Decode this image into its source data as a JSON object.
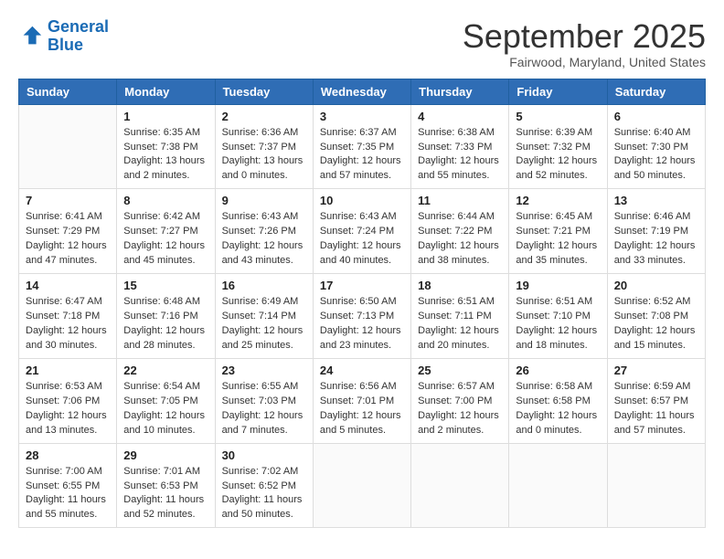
{
  "header": {
    "logo_line1": "General",
    "logo_line2": "Blue",
    "month": "September 2025",
    "location": "Fairwood, Maryland, United States"
  },
  "weekdays": [
    "Sunday",
    "Monday",
    "Tuesday",
    "Wednesday",
    "Thursday",
    "Friday",
    "Saturday"
  ],
  "weeks": [
    [
      {
        "day": "",
        "sunrise": "",
        "sunset": "",
        "daylight": ""
      },
      {
        "day": "1",
        "sunrise": "Sunrise: 6:35 AM",
        "sunset": "Sunset: 7:38 PM",
        "daylight": "Daylight: 13 hours and 2 minutes."
      },
      {
        "day": "2",
        "sunrise": "Sunrise: 6:36 AM",
        "sunset": "Sunset: 7:37 PM",
        "daylight": "Daylight: 13 hours and 0 minutes."
      },
      {
        "day": "3",
        "sunrise": "Sunrise: 6:37 AM",
        "sunset": "Sunset: 7:35 PM",
        "daylight": "Daylight: 12 hours and 57 minutes."
      },
      {
        "day": "4",
        "sunrise": "Sunrise: 6:38 AM",
        "sunset": "Sunset: 7:33 PM",
        "daylight": "Daylight: 12 hours and 55 minutes."
      },
      {
        "day": "5",
        "sunrise": "Sunrise: 6:39 AM",
        "sunset": "Sunset: 7:32 PM",
        "daylight": "Daylight: 12 hours and 52 minutes."
      },
      {
        "day": "6",
        "sunrise": "Sunrise: 6:40 AM",
        "sunset": "Sunset: 7:30 PM",
        "daylight": "Daylight: 12 hours and 50 minutes."
      }
    ],
    [
      {
        "day": "7",
        "sunrise": "Sunrise: 6:41 AM",
        "sunset": "Sunset: 7:29 PM",
        "daylight": "Daylight: 12 hours and 47 minutes."
      },
      {
        "day": "8",
        "sunrise": "Sunrise: 6:42 AM",
        "sunset": "Sunset: 7:27 PM",
        "daylight": "Daylight: 12 hours and 45 minutes."
      },
      {
        "day": "9",
        "sunrise": "Sunrise: 6:43 AM",
        "sunset": "Sunset: 7:26 PM",
        "daylight": "Daylight: 12 hours and 43 minutes."
      },
      {
        "day": "10",
        "sunrise": "Sunrise: 6:43 AM",
        "sunset": "Sunset: 7:24 PM",
        "daylight": "Daylight: 12 hours and 40 minutes."
      },
      {
        "day": "11",
        "sunrise": "Sunrise: 6:44 AM",
        "sunset": "Sunset: 7:22 PM",
        "daylight": "Daylight: 12 hours and 38 minutes."
      },
      {
        "day": "12",
        "sunrise": "Sunrise: 6:45 AM",
        "sunset": "Sunset: 7:21 PM",
        "daylight": "Daylight: 12 hours and 35 minutes."
      },
      {
        "day": "13",
        "sunrise": "Sunrise: 6:46 AM",
        "sunset": "Sunset: 7:19 PM",
        "daylight": "Daylight: 12 hours and 33 minutes."
      }
    ],
    [
      {
        "day": "14",
        "sunrise": "Sunrise: 6:47 AM",
        "sunset": "Sunset: 7:18 PM",
        "daylight": "Daylight: 12 hours and 30 minutes."
      },
      {
        "day": "15",
        "sunrise": "Sunrise: 6:48 AM",
        "sunset": "Sunset: 7:16 PM",
        "daylight": "Daylight: 12 hours and 28 minutes."
      },
      {
        "day": "16",
        "sunrise": "Sunrise: 6:49 AM",
        "sunset": "Sunset: 7:14 PM",
        "daylight": "Daylight: 12 hours and 25 minutes."
      },
      {
        "day": "17",
        "sunrise": "Sunrise: 6:50 AM",
        "sunset": "Sunset: 7:13 PM",
        "daylight": "Daylight: 12 hours and 23 minutes."
      },
      {
        "day": "18",
        "sunrise": "Sunrise: 6:51 AM",
        "sunset": "Sunset: 7:11 PM",
        "daylight": "Daylight: 12 hours and 20 minutes."
      },
      {
        "day": "19",
        "sunrise": "Sunrise: 6:51 AM",
        "sunset": "Sunset: 7:10 PM",
        "daylight": "Daylight: 12 hours and 18 minutes."
      },
      {
        "day": "20",
        "sunrise": "Sunrise: 6:52 AM",
        "sunset": "Sunset: 7:08 PM",
        "daylight": "Daylight: 12 hours and 15 minutes."
      }
    ],
    [
      {
        "day": "21",
        "sunrise": "Sunrise: 6:53 AM",
        "sunset": "Sunset: 7:06 PM",
        "daylight": "Daylight: 12 hours and 13 minutes."
      },
      {
        "day": "22",
        "sunrise": "Sunrise: 6:54 AM",
        "sunset": "Sunset: 7:05 PM",
        "daylight": "Daylight: 12 hours and 10 minutes."
      },
      {
        "day": "23",
        "sunrise": "Sunrise: 6:55 AM",
        "sunset": "Sunset: 7:03 PM",
        "daylight": "Daylight: 12 hours and 7 minutes."
      },
      {
        "day": "24",
        "sunrise": "Sunrise: 6:56 AM",
        "sunset": "Sunset: 7:01 PM",
        "daylight": "Daylight: 12 hours and 5 minutes."
      },
      {
        "day": "25",
        "sunrise": "Sunrise: 6:57 AM",
        "sunset": "Sunset: 7:00 PM",
        "daylight": "Daylight: 12 hours and 2 minutes."
      },
      {
        "day": "26",
        "sunrise": "Sunrise: 6:58 AM",
        "sunset": "Sunset: 6:58 PM",
        "daylight": "Daylight: 12 hours and 0 minutes."
      },
      {
        "day": "27",
        "sunrise": "Sunrise: 6:59 AM",
        "sunset": "Sunset: 6:57 PM",
        "daylight": "Daylight: 11 hours and 57 minutes."
      }
    ],
    [
      {
        "day": "28",
        "sunrise": "Sunrise: 7:00 AM",
        "sunset": "Sunset: 6:55 PM",
        "daylight": "Daylight: 11 hours and 55 minutes."
      },
      {
        "day": "29",
        "sunrise": "Sunrise: 7:01 AM",
        "sunset": "Sunset: 6:53 PM",
        "daylight": "Daylight: 11 hours and 52 minutes."
      },
      {
        "day": "30",
        "sunrise": "Sunrise: 7:02 AM",
        "sunset": "Sunset: 6:52 PM",
        "daylight": "Daylight: 11 hours and 50 minutes."
      },
      {
        "day": "",
        "sunrise": "",
        "sunset": "",
        "daylight": ""
      },
      {
        "day": "",
        "sunrise": "",
        "sunset": "",
        "daylight": ""
      },
      {
        "day": "",
        "sunrise": "",
        "sunset": "",
        "daylight": ""
      },
      {
        "day": "",
        "sunrise": "",
        "sunset": "",
        "daylight": ""
      }
    ]
  ]
}
